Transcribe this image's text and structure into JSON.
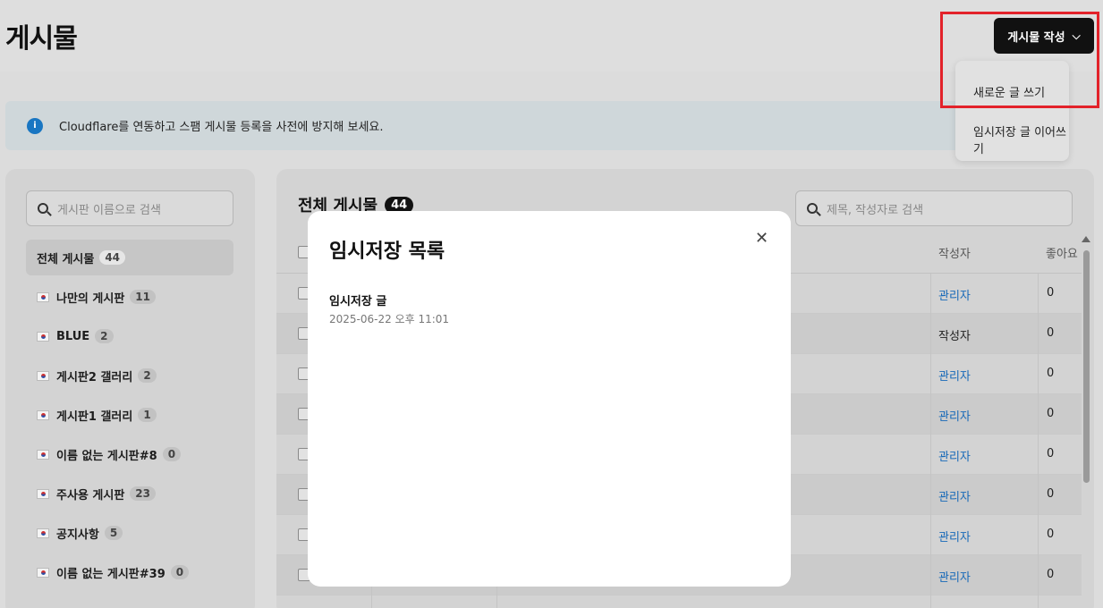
{
  "header": {
    "title": "게시물",
    "write_button": "게시물 작성",
    "chevron_icon": "chevron-down-icon"
  },
  "dropdown": {
    "items": [
      "새로운 글 쓰기",
      "임시저장 글 이어쓰기"
    ]
  },
  "banner": {
    "icon": "info-icon",
    "text": "Cloudflare를 연동하고 스팸 게시물 등록을 사전에 방지해 보세요."
  },
  "sidebar": {
    "search_placeholder": "게시판 이름으로 검색",
    "items": [
      {
        "label": "전체 게시물",
        "count": "44",
        "flag": false,
        "active": true
      },
      {
        "label": "나만의 게시판",
        "count": "11",
        "flag": true
      },
      {
        "label": "BLUE",
        "count": "2",
        "flag": true
      },
      {
        "label": "게시판2 갤러리",
        "count": "2",
        "flag": true
      },
      {
        "label": "게시판1 갤러리",
        "count": "1",
        "flag": true
      },
      {
        "label": "이름 없는 게시판#8",
        "count": "0",
        "flag": true
      },
      {
        "label": "주사용 게시판",
        "count": "23",
        "flag": true
      },
      {
        "label": "공지사항",
        "count": "5",
        "flag": true
      },
      {
        "label": "이름 없는 게시판#39",
        "count": "0",
        "flag": true
      }
    ]
  },
  "main": {
    "title": "전체 게시물",
    "count": "44",
    "search_placeholder": "제목, 작성자로 검색",
    "columns": {
      "author": "작성자",
      "likes": "좋아요"
    },
    "rows": [
      {
        "author": "관리자",
        "likes": "0",
        "link": true
      },
      {
        "author": "작성자",
        "likes": "0",
        "link": false
      },
      {
        "author": "관리자",
        "likes": "0",
        "link": true
      },
      {
        "author": "관리자",
        "likes": "0",
        "link": true
      },
      {
        "author": "관리자",
        "likes": "0",
        "link": true
      },
      {
        "author": "관리자",
        "likes": "0",
        "link": true
      },
      {
        "author": "관리자",
        "likes": "0",
        "link": true
      },
      {
        "author": "관리자",
        "likes": "0",
        "link": true
      }
    ]
  },
  "modal": {
    "title": "임시저장 목록",
    "close_icon": "close-icon",
    "drafts": [
      {
        "title": "임시저장 글",
        "date": "2025-06-22 오후 11:01"
      }
    ]
  },
  "colors": {
    "accent": "#111111",
    "link": "#1769b8",
    "highlight": "#e3222a",
    "info": "#1976c2"
  }
}
